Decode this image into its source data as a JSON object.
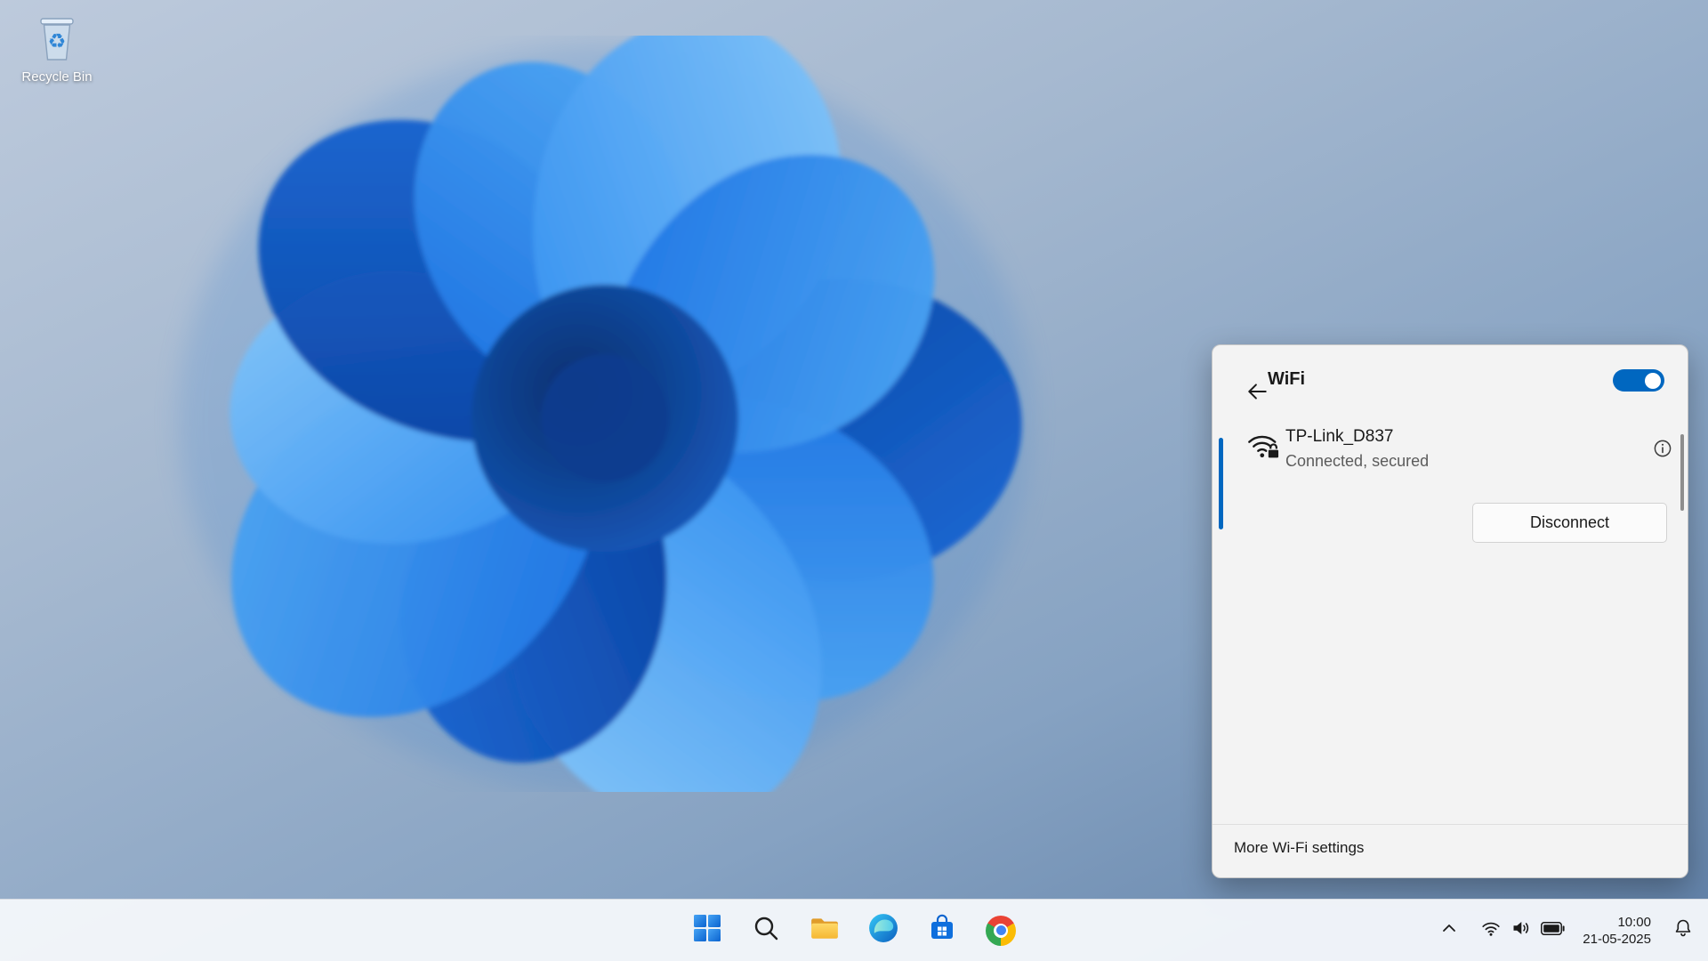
{
  "desktop": {
    "recycle_bin": {
      "label": "Recycle Bin",
      "icon": "recycle-bin-icon"
    },
    "wallpaper": "windows-11-bloom"
  },
  "wifi_panel": {
    "back_icon": "back-arrow-icon",
    "title": "WiFi",
    "toggle": {
      "state": "on",
      "color": "#0067c0"
    },
    "network": {
      "icon": "wifi-secured-icon",
      "name": "TP-Link_D837",
      "status": "Connected, secured",
      "info_icon": "info-icon",
      "disconnect_label": "Disconnect"
    },
    "footer": {
      "more_settings_label": "More Wi-Fi settings"
    }
  },
  "taskbar": {
    "center_icons": [
      "start",
      "search",
      "file-explorer",
      "edge",
      "microsoft-store",
      "chrome"
    ],
    "tray": {
      "icons": [
        "chevron-up",
        "wifi",
        "volume",
        "battery"
      ],
      "clock": {
        "time": "10:00",
        "date": "21-05-2025"
      },
      "bell_icon": "notification-bell-icon"
    }
  },
  "colors": {
    "accent": "#0067c0",
    "panel_bg": "#f3f3f3",
    "taskbar_bg": "#f3f6fa"
  }
}
